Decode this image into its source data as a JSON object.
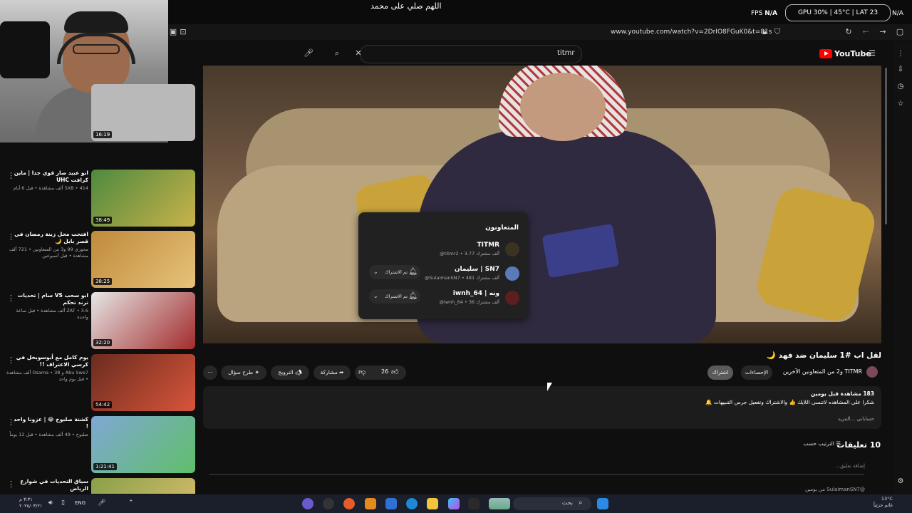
{
  "overlay": {
    "banner_text": "اللهم صلي على محمد",
    "fps_label": "FPS",
    "fps_value": "N/A",
    "gpu_pill": "GPU 30% | 45°C | LAT 23",
    "gpu_value": "N/A"
  },
  "browser": {
    "url": "www.youtube.com/watch?v=2DrIO8FGuK0&t=81s"
  },
  "header": {
    "logo_text": "YouTube",
    "search_value": "titmr"
  },
  "collaborators": {
    "title": "المتعاونون",
    "items": [
      {
        "name": "TITMR",
        "meta": "@titmr2 • 3.77 ألف مشترك",
        "subscribe": "",
        "avatar_color": "#3a3322"
      },
      {
        "name": "سليمان | SN7",
        "meta": "@SulaimanSN7 • 481 ألف مشترك",
        "subscribe": "تم الاشتراك",
        "avatar_color": "#5a7bb5"
      },
      {
        "name": "iwnh_64 | ونه",
        "meta": "@iwnh_64 • 36 ألف مشترك",
        "subscribe": "تم الاشتراك",
        "avatar_color": "#5a1f1f"
      }
    ]
  },
  "video": {
    "title": "لقل اب #1 سليمان ضد فهد 🌙",
    "channel_line": "TITMR و2 من المتعاونين الآخرين",
    "stats_button": "الإحصاءات",
    "subscribe_button": "اشتراك",
    "like_count": "26",
    "share_label": "مشاركة",
    "promote_label": "الترويج",
    "ask_label": "طرح سؤال"
  },
  "description": {
    "line1": "183 مشاهدة قبل يومين",
    "line2": "شكرا على المشاهده لاتنسى اللايك 👍 والاشتراك وتفعيل جرس التنبيهات 🔔",
    "line3": "حساباتي ...المزيد"
  },
  "comments": {
    "heading": "10 تعليقات",
    "sort_label": "الترتيب حسب",
    "add_placeholder": "إضافة تعليق...",
    "peek": "@SulaimanSN7 من يومين"
  },
  "sidebar": {
    "items": [
      {
        "title": "",
        "meta": "",
        "duration": "16:19",
        "thumb_color": "#b9b9b9"
      },
      {
        "title": "ابو عبيد صار قوي جدا | ماين كرافت UHC",
        "meta": "SXB • 414 ألف مشاهدة • قبل 6 أيام",
        "duration": "38:49",
        "thumb_color": "#4e8a3e"
      },
      {
        "title": "افتحت محل زينة رمضان في قصر بابل 🌙",
        "meta": "محوري 99 و3 من المتعاونين • 721 ألف مشاهدة • قبل أسبوعين",
        "duration": "38:25",
        "thumb_color": "#c08a3a"
      },
      {
        "title": "ابو سحب VS سام | تحديات ترند تحكم",
        "meta": "ZAT • 3.6 ألف مشاهدة • قبل ساعة واحدة",
        "duration": "32:20",
        "thumb_color": "#cfcfcf"
      },
      {
        "title": "يوم كامل مع أبوسوبخل في كرسي الاعتراف !!",
        "meta": "Abu Swe7 و Osama • 38 ألف مشاهدة • قبل يوم واحد",
        "duration": "54:42",
        "thumb_color": "#6b2c1f"
      },
      {
        "title": "كشتة صلبوخ 😂 | عزونا واحد !",
        "meta": "صلبوخ • 49 ألف مشاهدة • قبل 12 يوماً",
        "duration": "1:21:41",
        "thumb_color": "#7fa8d4"
      },
      {
        "title": "سباق التحديات في شوارع الرياض",
        "meta": "",
        "duration": "",
        "thumb_color": "#8aa04a"
      }
    ]
  },
  "taskbar": {
    "search_placeholder": "بحث",
    "lang": "ENG",
    "time": "٣:٣١ م",
    "date": "٢٠٢٥/٠٣/٢١",
    "temperature": "13°C",
    "weather": "غائم جزئياً"
  }
}
